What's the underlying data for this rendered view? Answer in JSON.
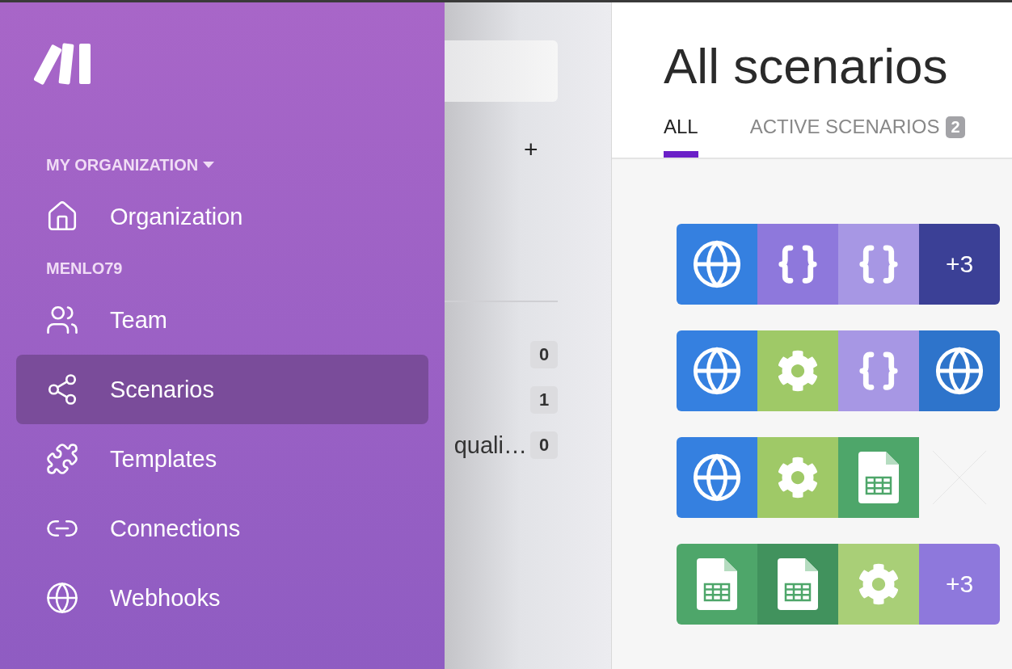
{
  "sidebar": {
    "items": [
      {
        "kind": "menu-heading",
        "label": "MY ORGANIZATION"
      },
      {
        "kind": "link",
        "label": "Organization",
        "selected": false
      },
      {
        "kind": "heading",
        "label": "MENLO79"
      },
      {
        "kind": "link",
        "label": "Team",
        "selected": false
      },
      {
        "kind": "link",
        "label": "Scenarios",
        "selected": true
      },
      {
        "kind": "link",
        "label": "Templates",
        "selected": false
      },
      {
        "kind": "link",
        "label": "Connections",
        "selected": false
      },
      {
        "kind": "link",
        "label": "Webhooks",
        "selected": false
      }
    ]
  },
  "folders": {
    "add_button": "+",
    "rows": [
      {
        "count": "0"
      },
      {
        "count": "1"
      },
      {
        "label": "quali…",
        "count": "0"
      }
    ]
  },
  "main": {
    "title": "All scenarios",
    "tabs": [
      {
        "label": "ALL",
        "selected": true
      },
      {
        "label": "ACTIVE SCENARIOS",
        "badge": "2",
        "selected": false
      }
    ],
    "scenarios": [
      {
        "tiles": [
          {
            "kind": "globe",
            "color": "#3580e0"
          },
          {
            "kind": "json",
            "color": "#8e78dc"
          },
          {
            "kind": "json",
            "color": "#a797e4"
          },
          {
            "kind": "more",
            "text": "+3",
            "color": "#3b4096"
          }
        ]
      },
      {
        "tiles": [
          {
            "kind": "globe",
            "color": "#3580e0"
          },
          {
            "kind": "gear",
            "color": "#9fc967"
          },
          {
            "kind": "json",
            "color": "#a797e4"
          },
          {
            "kind": "globe",
            "color": "#2e74cb"
          }
        ]
      },
      {
        "tiles": [
          {
            "kind": "globe",
            "color": "#3580e0"
          },
          {
            "kind": "gear",
            "color": "#9fc967"
          },
          {
            "kind": "sheet",
            "color": "#4ea66a"
          },
          {
            "kind": "empty"
          }
        ]
      },
      {
        "tiles": [
          {
            "kind": "sheet",
            "color": "#4ea66a"
          },
          {
            "kind": "sheet",
            "color": "#41925d"
          },
          {
            "kind": "gear",
            "color": "#a9cf77"
          },
          {
            "kind": "more",
            "text": "+3",
            "color": "#8e78dc"
          }
        ]
      }
    ]
  }
}
